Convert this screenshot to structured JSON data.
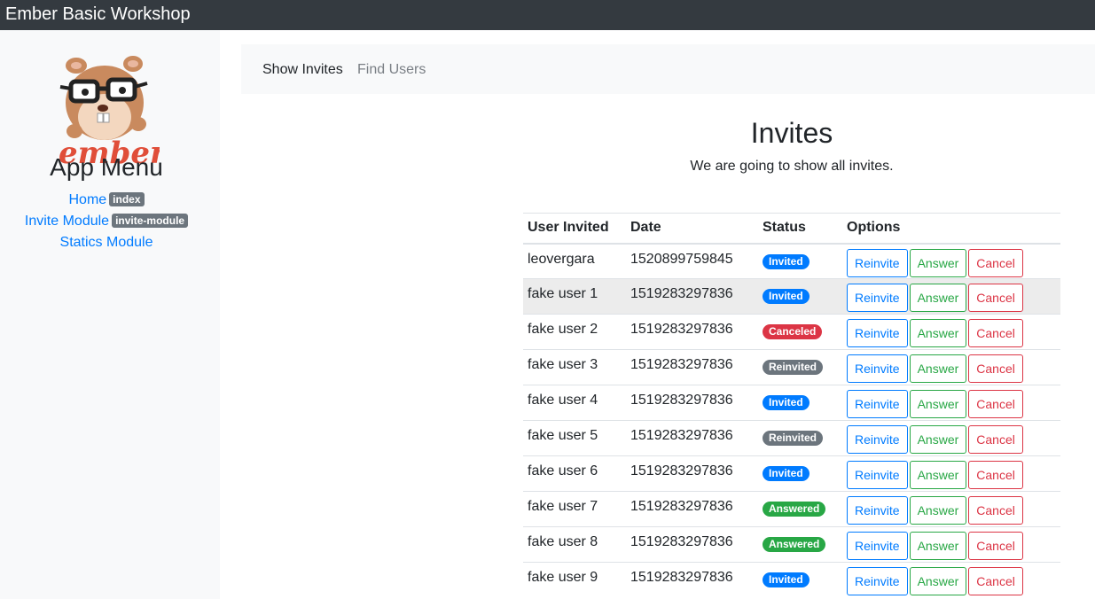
{
  "app": {
    "title": "Ember Basic Workshop"
  },
  "sidebar": {
    "title": "App Menu",
    "items": [
      {
        "label": "Home",
        "badge": "index"
      },
      {
        "label": "Invite Module",
        "badge": "invite-module"
      },
      {
        "label": "Statics Module",
        "badge": ""
      }
    ]
  },
  "subnav": {
    "tabs": [
      {
        "label": "Show Invites"
      },
      {
        "label": "Find Users"
      }
    ]
  },
  "main": {
    "title": "Invites",
    "lead": "We are going to show all invites."
  },
  "table": {
    "headers": [
      "User Invited",
      "Date",
      "Status",
      "Options"
    ],
    "buttons": {
      "reinvite": "Reinvite",
      "answer": "Answer",
      "cancel": "Cancel"
    },
    "status_colors": {
      "Invited": "#007bff",
      "Canceled": "#dc3545",
      "Reinvited": "#6c757d",
      "Answered": "#28a745"
    },
    "rows": [
      {
        "user": "leovergara",
        "date": "1520899759845",
        "status": "Invited"
      },
      {
        "user": "fake user 1",
        "date": "1519283297836",
        "status": "Invited"
      },
      {
        "user": "fake user 2",
        "date": "1519283297836",
        "status": "Canceled"
      },
      {
        "user": "fake user 3",
        "date": "1519283297836",
        "status": "Reinvited"
      },
      {
        "user": "fake user 4",
        "date": "1519283297836",
        "status": "Invited"
      },
      {
        "user": "fake user 5",
        "date": "1519283297836",
        "status": "Reinvited"
      },
      {
        "user": "fake user 6",
        "date": "1519283297836",
        "status": "Invited"
      },
      {
        "user": "fake user 7",
        "date": "1519283297836",
        "status": "Answered"
      },
      {
        "user": "fake user 8",
        "date": "1519283297836",
        "status": "Answered"
      },
      {
        "user": "fake user 9",
        "date": "1519283297836",
        "status": "Invited"
      }
    ]
  },
  "logo": {
    "icon": "ember-hamster-logo-icon",
    "wordmark": "ember"
  }
}
